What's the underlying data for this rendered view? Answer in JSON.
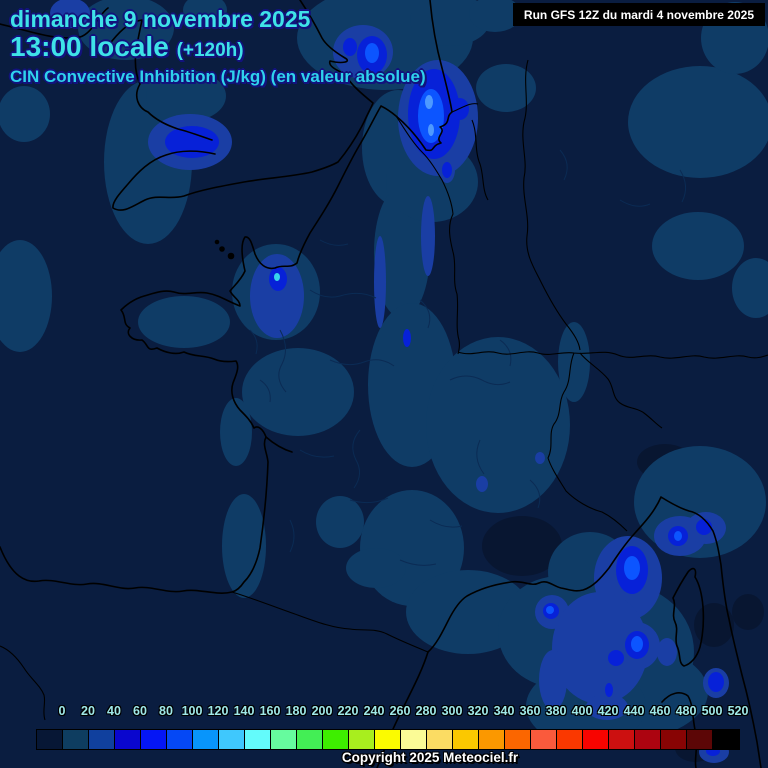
{
  "header": {
    "date_line": "dimanche 9 novembre 2025",
    "time_line": "13:00 locale",
    "offset_label": "(+120h)",
    "run_info": "Run GFS 12Z du mardi 4 novembre 2025",
    "subtitle": "CIN Convective Inhibition (J/kg) (en valeur absolue)"
  },
  "footer": {
    "copyright": "Copyright 2025 Meteociel.fr"
  },
  "colors": {
    "header_text": "#3FE2E8",
    "subtitle_text": "#2FD2EC",
    "run_box_background": "#000000",
    "run_box_text": "#FFFFFF",
    "map_background": "#0A1D40",
    "cin_level_0_20": "#0F3C66",
    "cin_level_20_40": "#1A3EA4",
    "cin_level_60_80": "#0721D8",
    "cin_level_100": "#0C55FF",
    "coastline": "#000000"
  },
  "legend": {
    "tick_labels": [
      "0",
      "20",
      "40",
      "60",
      "80",
      "100",
      "120",
      "140",
      "160",
      "180",
      "200",
      "220",
      "240",
      "260",
      "280",
      "300",
      "320",
      "340",
      "360",
      "380",
      "400",
      "420",
      "440",
      "460",
      "480",
      "500",
      "520"
    ],
    "swatch_colors": [
      "#071735",
      "#0E3D60",
      "#10409E",
      "#0A06CE",
      "#0516F5",
      "#0548F5",
      "#0895FB",
      "#3FC8FD",
      "#63FBFB",
      "#66FB9E",
      "#43EE55",
      "#3EEE00",
      "#A8EE1E",
      "#FBFB00",
      "#FBFB96",
      "#FBDC63",
      "#FBC800",
      "#FB9800",
      "#FB6600",
      "#FA5A3C",
      "#FA3800",
      "#F80400",
      "#CC1010",
      "#AC0410",
      "#880404",
      "#5C0606",
      "#000000"
    ]
  }
}
